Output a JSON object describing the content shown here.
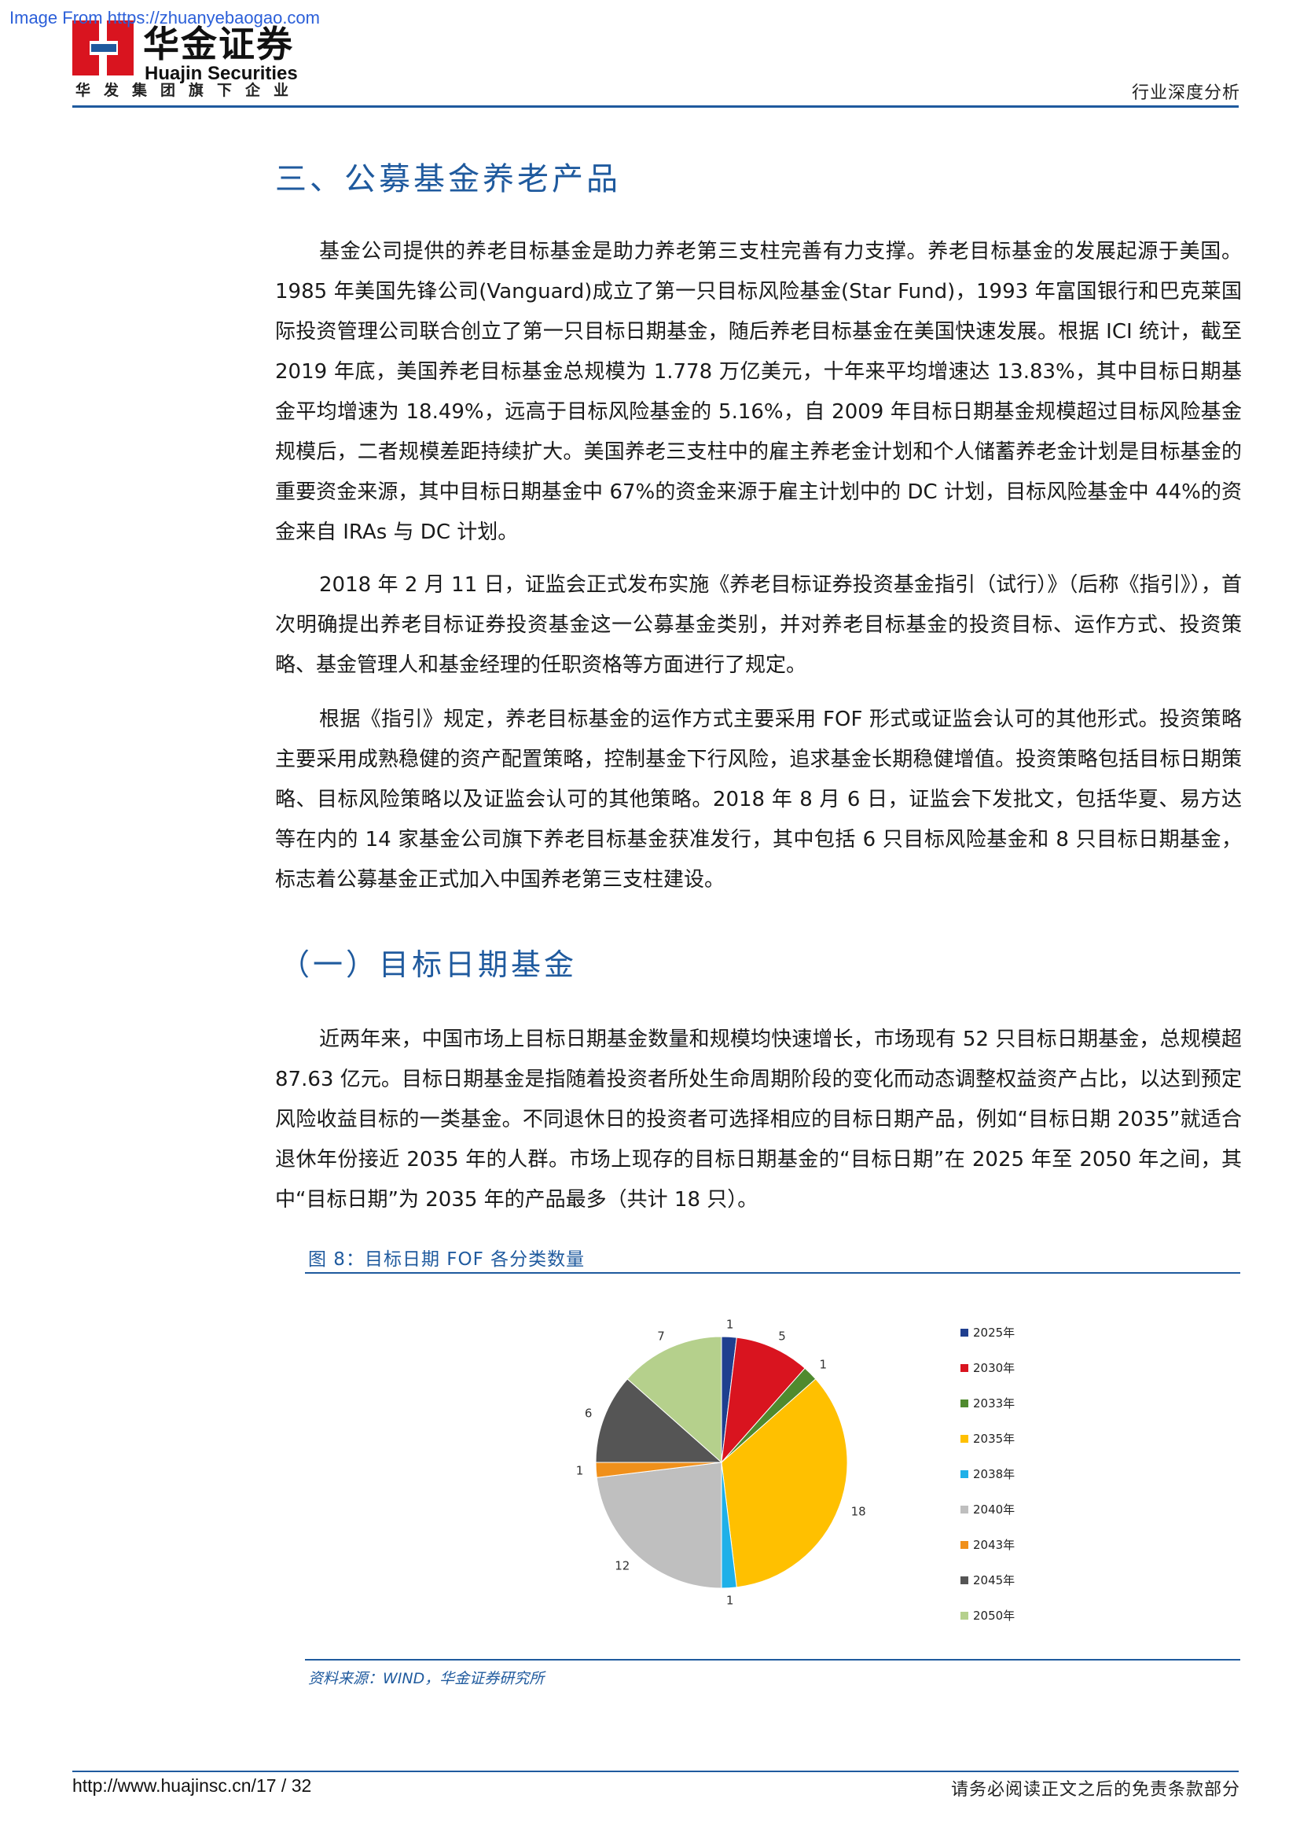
{
  "watermark": "Image From https://zhuanyebaogao.com",
  "header": {
    "logo_cn": "华金证券",
    "logo_en": "Huajin Securities",
    "group": "华发集团旗下企业",
    "report_type": "行业深度分析"
  },
  "section": {
    "title": "三、公募基金养老产品",
    "paragraphs": [
      "基金公司提供的养老目标基金是助力养老第三支柱完善有力支撑。养老目标基金的发展起源于美国。1985 年美国先锋公司(Vanguard)成立了第一只目标风险基金(Star Fund)，1993 年富国银行和巴克莱国际投资管理公司联合创立了第一只目标日期基金，随后养老目标基金在美国快速发展。根据 ICI 统计，截至 2019 年底，美国养老目标基金总规模为 1.778 万亿美元，十年来平均增速达 13.83%，其中目标日期基金平均增速为 18.49%，远高于目标风险基金的 5.16%，自 2009 年目标日期基金规模超过目标风险基金规模后，二者规模差距持续扩大。美国养老三支柱中的雇主养老金计划和个人储蓄养老金计划是目标基金的重要资金来源，其中目标日期基金中 67%的资金来源于雇主计划中的 DC 计划，目标风险基金中 44%的资金来自 IRAs 与 DC 计划。",
      "2018 年 2 月 11 日，证监会正式发布实施《养老目标证券投资基金指引（试行）》（后称《指引》），首次明确提出养老目标证券投资基金这一公募基金类别，并对养老目标基金的投资目标、运作方式、投资策略、基金管理人和基金经理的任职资格等方面进行了规定。",
      "根据《指引》规定，养老目标基金的运作方式主要采用 FOF 形式或证监会认可的其他形式。投资策略主要采用成熟稳健的资产配置策略，控制基金下行风险，追求基金长期稳健增值。投资策略包括目标日期策略、目标风险策略以及证监会认可的其他策略。2018 年 8 月 6 日，证监会下发批文，包括华夏、易方达等在内的 14 家基金公司旗下养老目标基金获准发行，其中包括 6 只目标风险基金和 8 只目标日期基金，标志着公募基金正式加入中国养老第三支柱建设。"
    ]
  },
  "subsection": {
    "title": "（一）目标日期基金",
    "paragraph": "近两年来，中国市场上目标日期基金数量和规模均快速增长，市场现有 52 只目标日期基金，总规模超 87.63 亿元。目标日期基金是指随着投资者所处生命周期阶段的变化而动态调整权益资产占比，以达到预定风险收益目标的一类基金。不同退休日的投资者可选择相应的目标日期产品，例如“目标日期 2035”就适合退休年份接近 2035 年的人群。市场上现存的目标日期基金的“目标日期”在 2025 年至 2050 年之间，其中“目标日期”为 2035 年的产品最多（共计 18 只）。"
  },
  "figure": {
    "caption": "图 8：目标日期 FOF 各分类数量",
    "source": "资料来源：WIND，华金证券研究所"
  },
  "chart_data": {
    "type": "pie",
    "title": "",
    "categories": [
      "2025年",
      "2030年",
      "2033年",
      "2035年",
      "2038年",
      "2040年",
      "2043年",
      "2045年",
      "2050年"
    ],
    "values": [
      1,
      5,
      1,
      18,
      1,
      12,
      1,
      6,
      7
    ],
    "colors": [
      "#1f3f8f",
      "#d9141f",
      "#4f8a2e",
      "#ffc000",
      "#1fb0e8",
      "#bfbfbf",
      "#f0901b",
      "#555555",
      "#b5d08c"
    ],
    "legend_position": "right"
  },
  "footer": {
    "left": "http://www.huajinsc.cn/17 / 32",
    "right": "请务必阅读正文之后的免责条款部分"
  }
}
